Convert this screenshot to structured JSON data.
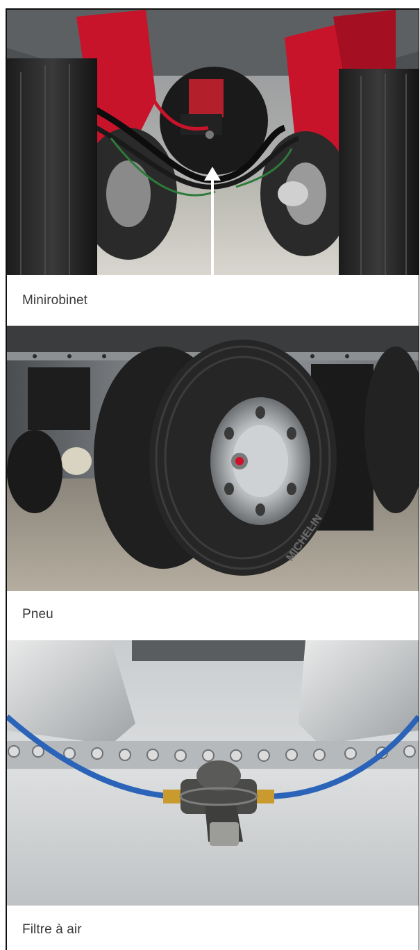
{
  "items": [
    {
      "caption": "Minirobinet",
      "photo": "trailer-underside-minirobinet"
    },
    {
      "caption": "Pneu",
      "photo": "dual-tires-michelin"
    },
    {
      "caption": "Filtre à air",
      "photo": "air-filter-blue-hose"
    }
  ],
  "tire_brand": "MICHELIN",
  "colors": {
    "frame_red": "#c8142a",
    "hose_blue": "#2a63b8",
    "caption_text": "#3a3a3a"
  }
}
